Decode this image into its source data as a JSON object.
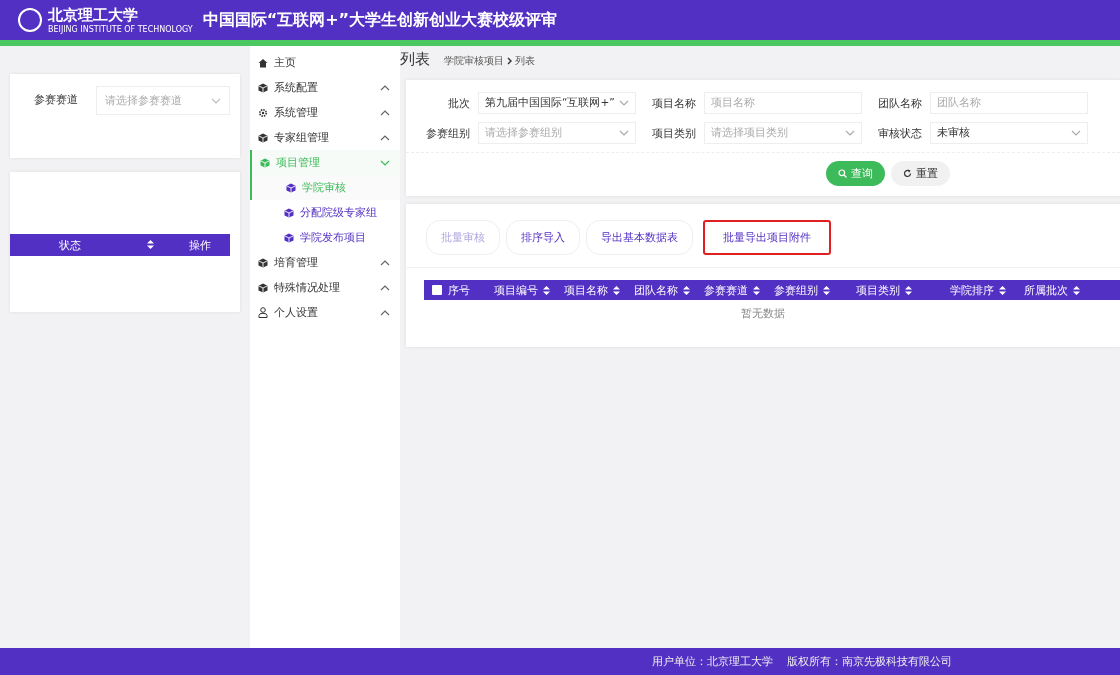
{
  "header": {
    "logo_text": "北京理工大学",
    "logo_subtext": "BEIJING INSTITUTE OF TECHNOLOGY",
    "title": "中国国际“互联网+”大学生创新创业大赛校级评审"
  },
  "left_panel": {
    "filter": {
      "label": "参赛赛道",
      "placeholder": "请选择参赛赛道"
    },
    "table_columns": [
      "状态",
      "操作"
    ]
  },
  "sidebar": {
    "items": [
      {
        "label": "主页",
        "kind": "link",
        "selected": false
      },
      {
        "label": "系统配置",
        "kind": "group",
        "expanded": false,
        "selected": false
      },
      {
        "label": "系统管理",
        "kind": "group",
        "expanded": false,
        "selected": false
      },
      {
        "label": "专家组管理",
        "kind": "group",
        "expanded": false,
        "selected": false
      },
      {
        "label": "项目管理",
        "kind": "group",
        "expanded": true,
        "selected": true,
        "children": [
          {
            "label": "学院审核",
            "selected": true
          },
          {
            "label": "分配院级专家组",
            "selected": false
          },
          {
            "label": "学院发布项目",
            "selected": false
          }
        ]
      },
      {
        "label": "培育管理",
        "kind": "group",
        "expanded": false,
        "selected": false
      },
      {
        "label": "特殊情况处理",
        "kind": "group",
        "expanded": false,
        "selected": false
      },
      {
        "label": "个人设置",
        "kind": "group",
        "expanded": false,
        "selected": false
      }
    ]
  },
  "page": {
    "title": "列表",
    "breadcrumb": [
      "学院审核项目",
      "列表"
    ]
  },
  "filters": [
    {
      "label": "批次",
      "value": "第九届中国国际“互联网+”"
    },
    {
      "label": "项目名称",
      "placeholder": "项目名称",
      "kind": "input"
    },
    {
      "label": "团队名称",
      "placeholder": "团队名称",
      "kind": "input"
    },
    {
      "label": "参赛组别",
      "placeholder": "请选择参赛组别"
    },
    {
      "label": "项目类别",
      "placeholder": "请选择项目类别"
    },
    {
      "label": "审核状态",
      "value": "未审核"
    }
  ],
  "query_buttons": [
    {
      "label": "查询",
      "kind": "primary"
    },
    {
      "label": "重置",
      "kind": "reset"
    }
  ],
  "actions": [
    {
      "label": "批量审核",
      "disabled": true,
      "highlighted": false
    },
    {
      "label": "排序导入",
      "disabled": false,
      "highlighted": false
    },
    {
      "label": "导出基本数据表",
      "disabled": false,
      "highlighted": false
    },
    {
      "label": "批量导出项目附件",
      "disabled": false,
      "highlighted": true
    }
  ],
  "table": {
    "select_all": {
      "checked": false
    },
    "columns": [
      {
        "label": "序号",
        "sortable": false
      },
      {
        "label": "项目编号",
        "sortable": true
      },
      {
        "label": "项目名称",
        "sortable": true
      },
      {
        "label": "团队名称",
        "sortable": true
      },
      {
        "label": "参赛赛道",
        "sortable": true
      },
      {
        "label": "参赛组别",
        "sortable": true
      },
      {
        "label": "项目类别",
        "sortable": true
      },
      {
        "label": "学院排序",
        "sortable": true
      },
      {
        "label": "所属批次",
        "sortable": true
      }
    ],
    "empty_text": "暂无数据"
  },
  "footer": {
    "items": [
      "用户单位：北京理工大学",
      "版权所有：南京先极科技有限公司"
    ]
  }
}
